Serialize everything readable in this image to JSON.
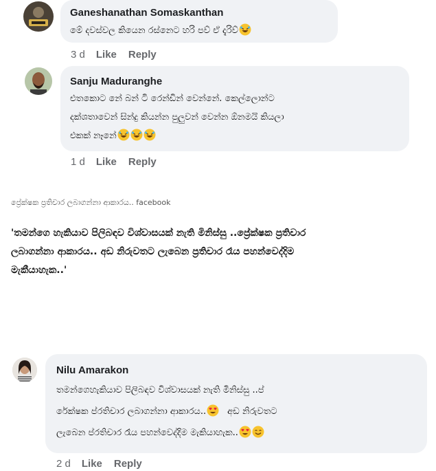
{
  "comments": [
    {
      "author": "Ganeshanathan Somaskanthan",
      "lines": [
        "මේ දවස්වල කියෙන රස්නෙට හරි පව් ඒ දැරිව්"
      ],
      "emojis": [
        "rofl"
      ],
      "time": "3 d",
      "like_label": "Like",
      "reply_label": "Reply"
    },
    {
      "author": "Sanju Maduranghe",
      "lines": [
        "එතකොට නේ බන් ටි රෙන්ඩින් වෙන්නේ. කෙල්ලොන්ට",
        "දක්ශතාවෙන් සින්දු කියන්න පුලුවන් වෙන්න ඕනමයි කියලා",
        "එකක් නෑනේ"
      ],
      "emojis": [
        "rofl",
        "rofl",
        "rofl"
      ],
      "time": "1 d",
      "like_label": "Like",
      "reply_label": "Reply"
    },
    {
      "author": "Nilu Amarakon",
      "lines": [
        "තමන්ගෙහැකියාව පිලිබඳව විශ්වාසයක් නැති මිනිස්සු ..ප්",
        "රේක්ෂක ප්රතිචාර ලබාගන්නා ආකාරය..",
        "ලැබෙන ප්රතිචාර රෑය පහන්වෙද්දිම මැකියාහැක.."
      ],
      "line2_tail": "අඩ නිරුවතට",
      "emojis_line2": [
        "heart-eyes"
      ],
      "emojis_line3": [
        "heart-eyes",
        "smile"
      ],
      "time": "2 d",
      "like_label": "Like",
      "reply_label": "Reply"
    }
  ],
  "caption": "ප්‍රේක්ෂක ප්‍රතිචාර ලබාගන්නා ආකාරය.. facebook",
  "quote_lines": [
    "'තමන්ගෙ හැකියාව පිලිබඳව විශ්වාසයක් නැති මිනිස්සු ..ප්‍රේක්ෂක ප්‍රතිචාර",
    "ලබාගන්නා ආකාරය.. අඩ නිරුවතට ලැබෙන ප්‍රතිචාර රෑය පහන්වෙද්දිම",
    "මැකීයාහැක..'"
  ],
  "colors": {
    "bubble": "#f0f2f5",
    "meta": "#65676b",
    "emoji_face": "#f7c32e"
  }
}
